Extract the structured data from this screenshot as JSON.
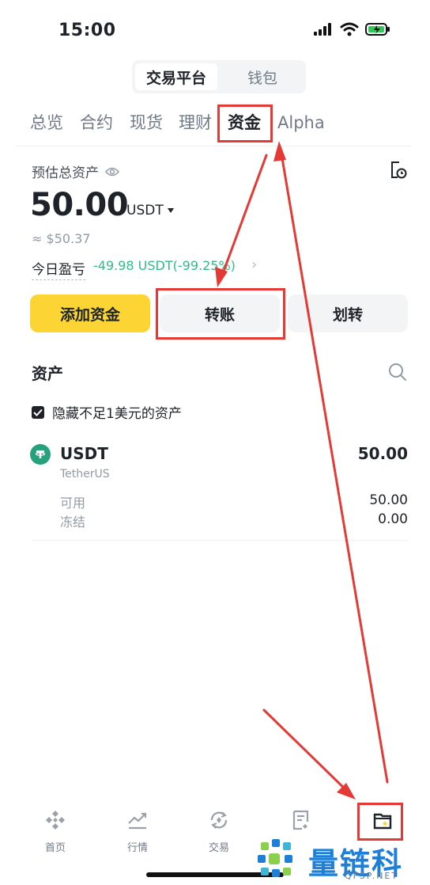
{
  "status_bar": {
    "time": "15:00"
  },
  "segment": {
    "active": "交易平台",
    "inactive": "钱包"
  },
  "tabs": [
    {
      "label": "总览"
    },
    {
      "label": "合约"
    },
    {
      "label": "现货"
    },
    {
      "label": "理财"
    },
    {
      "label": "资金"
    },
    {
      "label": "Alpha"
    }
  ],
  "estimate": {
    "label": "预估总资产",
    "value": "50.00",
    "unit": "USDT",
    "approx": "≈ $50.37",
    "pnl_label": "今日盈亏",
    "pnl_value": "-49.98 USDT(-99.25%)"
  },
  "actions": {
    "add": "添加资金",
    "transfer": "转账",
    "move": "划转"
  },
  "assets": {
    "title": "资产",
    "hide_small": "隐藏不足1美元的资产",
    "items": [
      {
        "symbol": "USDT",
        "name": "TetherUS",
        "total": "50.00",
        "available_label": "可用",
        "available": "50.00",
        "frozen_label": "冻结",
        "frozen": "0.00"
      }
    ]
  },
  "bottom_nav": [
    {
      "label": "首页"
    },
    {
      "label": "行情"
    },
    {
      "label": "交易"
    },
    {
      "label": ""
    },
    {
      "label": ""
    }
  ],
  "watermark": {
    "text": "量链科技",
    "sub": "QFSP.NET"
  },
  "colors": {
    "accent": "#FCD535",
    "positive": "#2EBD85",
    "annotation": "#E53935",
    "usdt": "#26A17B"
  }
}
